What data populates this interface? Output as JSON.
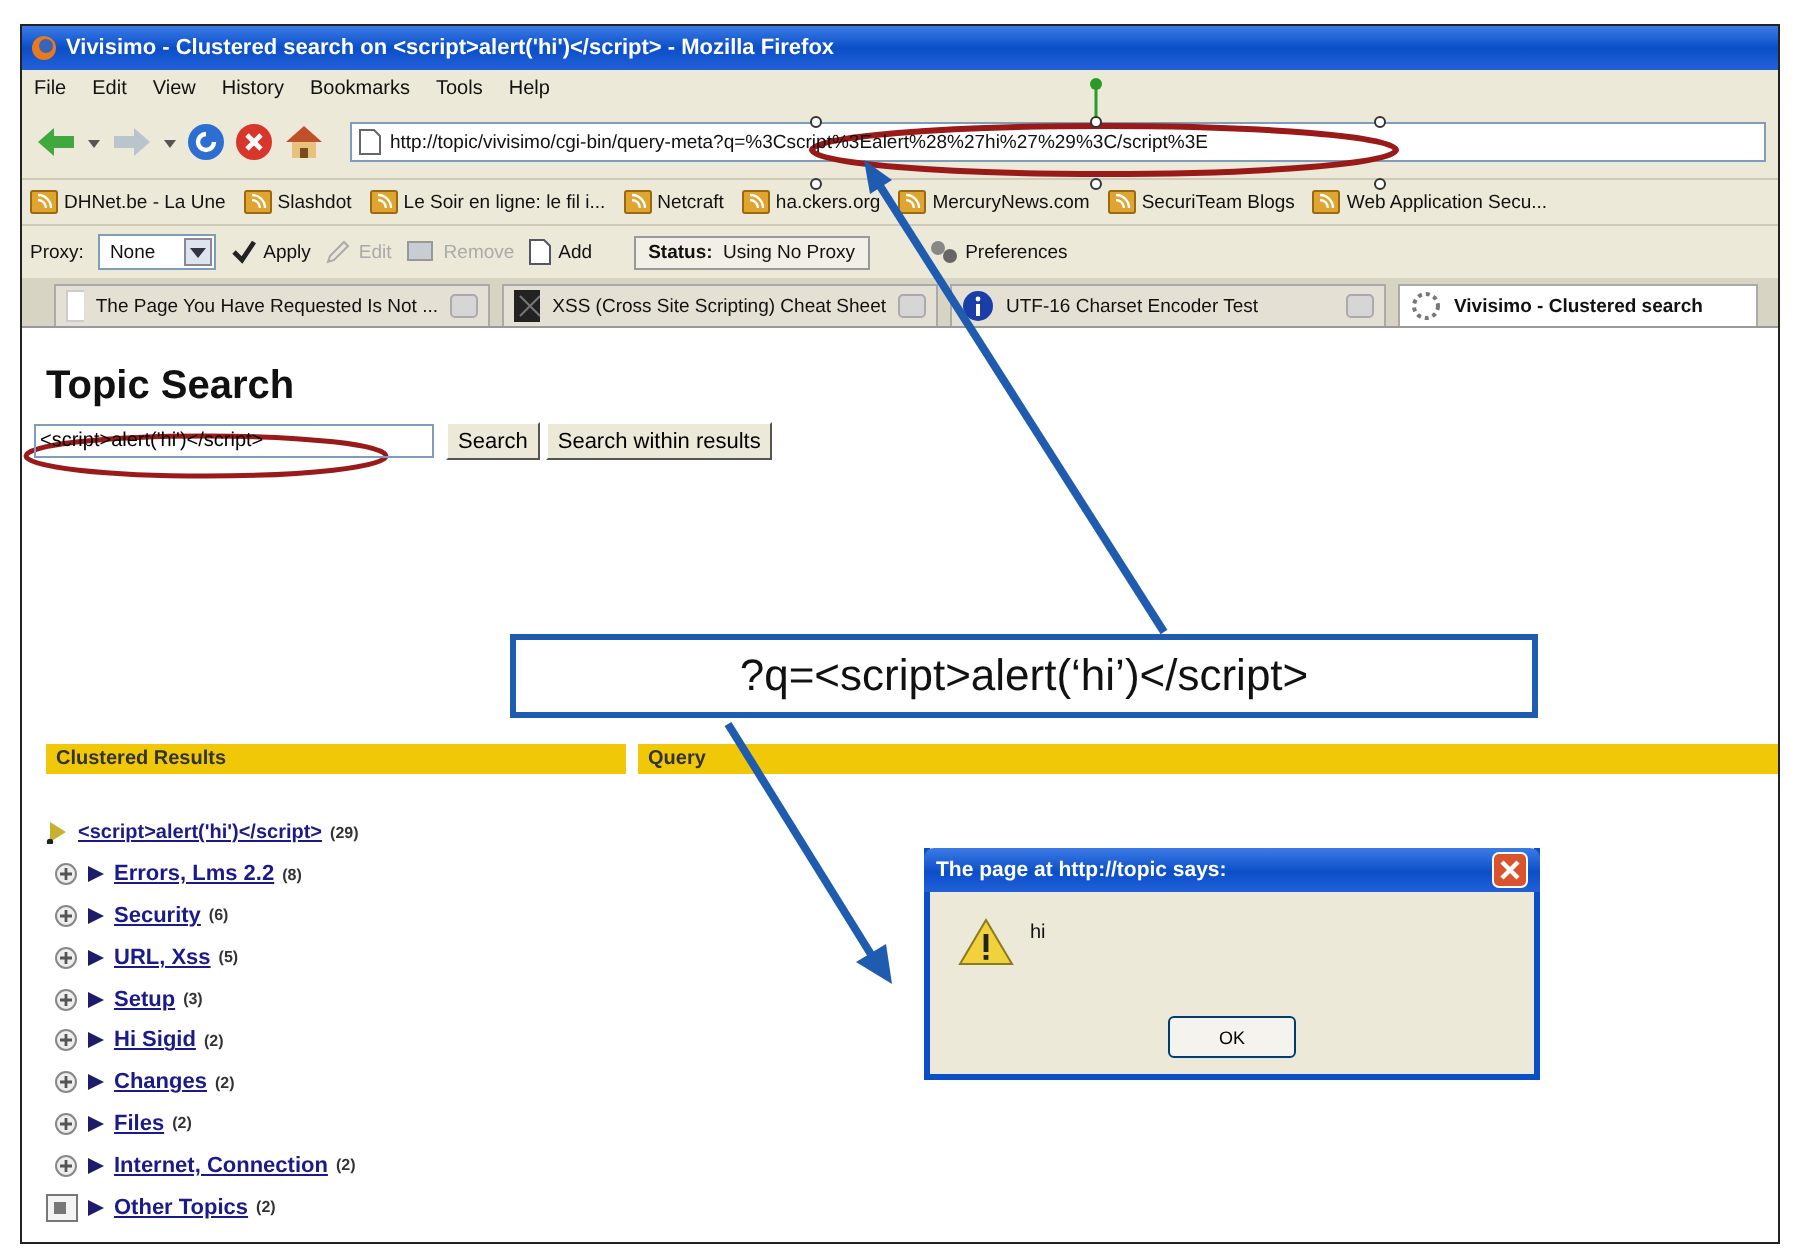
{
  "window": {
    "title": "Vivisimo - Clustered search on <script>alert('hi')</script> - Mozilla Firefox"
  },
  "menu": [
    "File",
    "Edit",
    "View",
    "History",
    "Bookmarks",
    "Tools",
    "Help"
  ],
  "address": {
    "url": "http://topic/vivisimo/cgi-bin/query-meta?q=%3Cscript%3Ealert%28%27hi%27%29%3C/script%3E"
  },
  "bookmarks": [
    "DHNet.be - La Une",
    "Slashdot",
    "Le Soir en ligne: le fil i...",
    "Netcraft",
    "ha.ckers.org",
    "MercuryNews.com",
    "SecuriTeam Blogs",
    "Web Application Secu..."
  ],
  "proxy_bar": {
    "label": "Proxy:",
    "select": "None",
    "buttons": [
      {
        "label": "Apply",
        "disabled": false,
        "kind": "check"
      },
      {
        "label": "Edit",
        "disabled": true,
        "kind": "pencil"
      },
      {
        "label": "Remove",
        "disabled": true,
        "kind": "remove"
      },
      {
        "label": "Add",
        "disabled": false,
        "kind": "page"
      }
    ],
    "status_label": "Status:",
    "status": "Using No Proxy",
    "preferences": "Preferences"
  },
  "tabs": [
    {
      "label": "The Page You Have Requested Is Not ...",
      "selected": false,
      "kind": "blank"
    },
    {
      "label": "XSS (Cross Site Scripting) Cheat Sheet",
      "selected": false,
      "kind": "dark"
    },
    {
      "label": "UTF-16 Charset Encoder Test",
      "selected": false,
      "kind": "info"
    },
    {
      "label": "Vivisimo - Clustered search",
      "selected": true,
      "kind": "loading"
    }
  ],
  "page": {
    "heading": "Topic Search",
    "search_value": "<script>alert('hi')</script>",
    "buttons": [
      "Search",
      "Search within results"
    ]
  },
  "results": {
    "headers": [
      "Clustered Results",
      "Query"
    ],
    "tree": {
      "label": "<script>alert('hi')</script>",
      "count": "(29)",
      "children": [
        {
          "label": "Errors, Lms 2.2",
          "count": "(8)",
          "kind": "cluster"
        },
        {
          "label": "Security",
          "count": "(6)",
          "kind": "cluster"
        },
        {
          "label": "URL, Xss",
          "count": "(5)",
          "kind": "cluster"
        },
        {
          "label": "Setup",
          "count": "(3)",
          "kind": "cluster"
        },
        {
          "label": "Hi Sigid",
          "count": "(2)",
          "kind": "cluster"
        },
        {
          "label": "Changes",
          "count": "(2)",
          "kind": "cluster"
        },
        {
          "label": "Files",
          "count": "(2)",
          "kind": "cluster"
        },
        {
          "label": "Internet, Connection",
          "count": "(2)",
          "kind": "cluster"
        },
        {
          "label": "Other Topics",
          "count": "(2)",
          "kind": "other"
        }
      ]
    }
  },
  "callout": {
    "text": "?q=<script>alert(‘hi’)</script>"
  },
  "dialog": {
    "title": "The page at http://topic says:",
    "message": "hi",
    "button": "OK"
  }
}
